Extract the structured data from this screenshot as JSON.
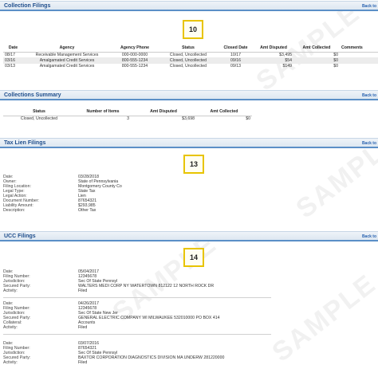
{
  "collection_filings": {
    "title": "Collection Filings",
    "back": "Back to",
    "badge": "10",
    "columns": [
      "Date",
      "Agency",
      "Agency Phone",
      "Status",
      "Closed Date",
      "Amt Disputed",
      "Amt Collected",
      "Comments"
    ],
    "rows": [
      [
        "08/17",
        "Receivable Management Services",
        "000-000-0000",
        "Closed, Uncollected",
        "10/17",
        "$3,495",
        "$0",
        ""
      ],
      [
        "03/16",
        "Amalgamated Credit Services",
        "800-555-1234",
        "Closed, Uncollected",
        "09/16",
        "$54",
        "$0",
        ""
      ],
      [
        "03/13",
        "Amalgamated Credit Services",
        "800-555-1234",
        "Closed, Uncollected",
        "09/13",
        "$149",
        "$0",
        ""
      ]
    ]
  },
  "collections_summary": {
    "title": "Collections Summary",
    "back": "Back to",
    "columns": [
      "Status",
      "Number of Items",
      "Amt Disputed",
      "Amt Collected"
    ],
    "rows": [
      [
        "Closed, Uncollected",
        "3",
        "$3,698",
        "$0"
      ]
    ]
  },
  "tax_lien_filings": {
    "title": "Tax Lien Filings",
    "back": "Back to",
    "badge": "13",
    "fields": [
      {
        "label": "Date:",
        "value": "03/28/2018"
      },
      {
        "label": "Owner:",
        "value": "State of Pennsylvania"
      },
      {
        "label": "Filing Location:",
        "value": "Montgomery County Co"
      },
      {
        "label": "Legal Type:",
        "value": "State Tax"
      },
      {
        "label": "Legal Action:",
        "value": "Lien"
      },
      {
        "label": "Document Number:",
        "value": "87654321"
      },
      {
        "label": "Liability Amount:",
        "value": "$293,985"
      },
      {
        "label": "Description:",
        "value": "Other Tax"
      }
    ]
  },
  "ucc_filings": {
    "title": "UCC Filings",
    "back": "Back to",
    "badge": "14",
    "entries": [
      {
        "fields": [
          {
            "label": "Date:",
            "value": "05/04/2017"
          },
          {
            "label": "Filing Number:",
            "value": "12345678"
          },
          {
            "label": "Jurisdiction:",
            "value": "Sec Of State Pennsyl"
          },
          {
            "label": "Secured Party:",
            "value": "WALTERS MEDI CORP NY WATERTOWN 812122 12 NORTH ROCK DR"
          },
          {
            "label": "Activity:",
            "value": "Filed"
          }
        ]
      },
      {
        "fields": [
          {
            "label": "Date:",
            "value": "04/26/2017"
          },
          {
            "label": "Filing Number:",
            "value": "12345678"
          },
          {
            "label": "Jurisdiction:",
            "value": "Sec Of State New Jer"
          },
          {
            "label": "Secured Party:",
            "value": "GENERAL ELECTRIC COMPANY WI MILWAUKEE 532010000 PO BOX 414"
          },
          {
            "label": "Collateral:",
            "value": "Accounts"
          },
          {
            "label": "Activity:",
            "value": "Filed"
          }
        ]
      },
      {
        "fields": [
          {
            "label": "Date:",
            "value": "03/07/2016"
          },
          {
            "label": "Filing Number:",
            "value": "87654321"
          },
          {
            "label": "Jurisdiction:",
            "value": "Sec Of State Pennsyl"
          },
          {
            "label": "Secured Party:",
            "value": "BAXTOR CORPORATION DIAGNOSTICS DIVISION MA UNDERW 281220000"
          },
          {
            "label": "Activity:",
            "value": "Filed"
          }
        ]
      }
    ]
  },
  "watermark_text": "SAMPLE"
}
